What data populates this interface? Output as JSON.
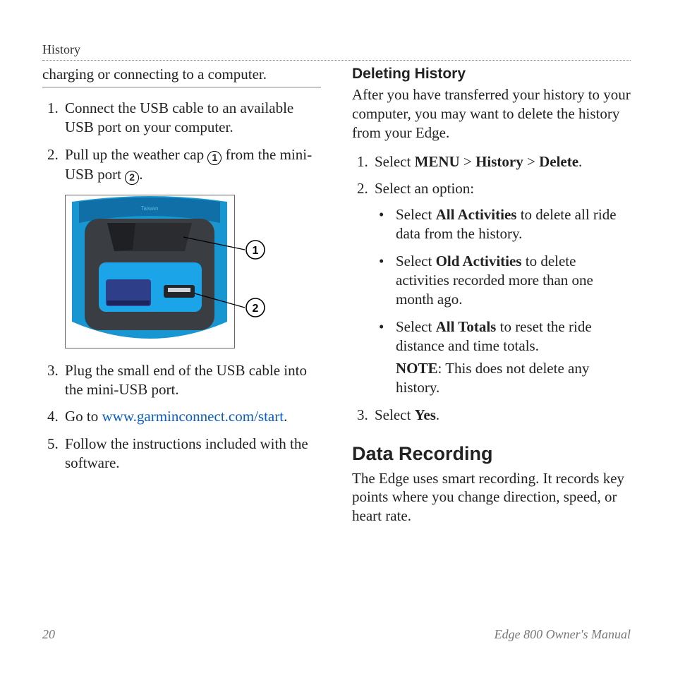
{
  "runningHead": "History",
  "left": {
    "introFragment": "charging or connecting to a computer.",
    "steps": {
      "s1": "Connect the USB cable to an available USB port on your computer.",
      "s2a": "Pull up the weather cap ",
      "s2b": " from the mini-USB port ",
      "s2c": ".",
      "s3": "Plug the small end of the USB cable into the mini-USB port.",
      "s4a": "Go to ",
      "s4link": "www.garminconnect.com/start",
      "s4b": ".",
      "s5": "Follow the instructions included with the software."
    },
    "callouts": {
      "one": "1",
      "two": "2"
    },
    "figureLabel": "Taiwan"
  },
  "right": {
    "sub1Title": "Deleting History",
    "sub1Intro": "After you have transferred your history to your computer, you may want to delete the history from your Edge.",
    "del": {
      "s1a": "Select ",
      "s1menu": "MENU",
      "s1sep1": " > ",
      "s1hist": "History",
      "s1sep2": " > ",
      "s1del": "Delete",
      "s1end": ".",
      "s2": "Select an option:",
      "opt1a": "Select ",
      "opt1b": "All Activities",
      "opt1c": " to delete all ride data from the history.",
      "opt2a": "Select ",
      "opt2b": "Old Activities",
      "opt2c": " to delete activities recorded more than one month ago.",
      "opt3a": "Select ",
      "opt3b": "All Totals",
      "opt3c": " to reset the ride distance and time totals.",
      "noteLabel": "NOTE",
      "noteBody": ": This does not delete any history.",
      "s3a": "Select ",
      "s3b": "Yes",
      "s3c": "."
    },
    "sectionTitle": "Data Recording",
    "sectionBody": "The Edge uses smart recording. It records key points where you change direction, speed, or heart rate."
  },
  "footer": {
    "pageNum": "20",
    "docTitle": "Edge 800 Owner's Manual"
  }
}
